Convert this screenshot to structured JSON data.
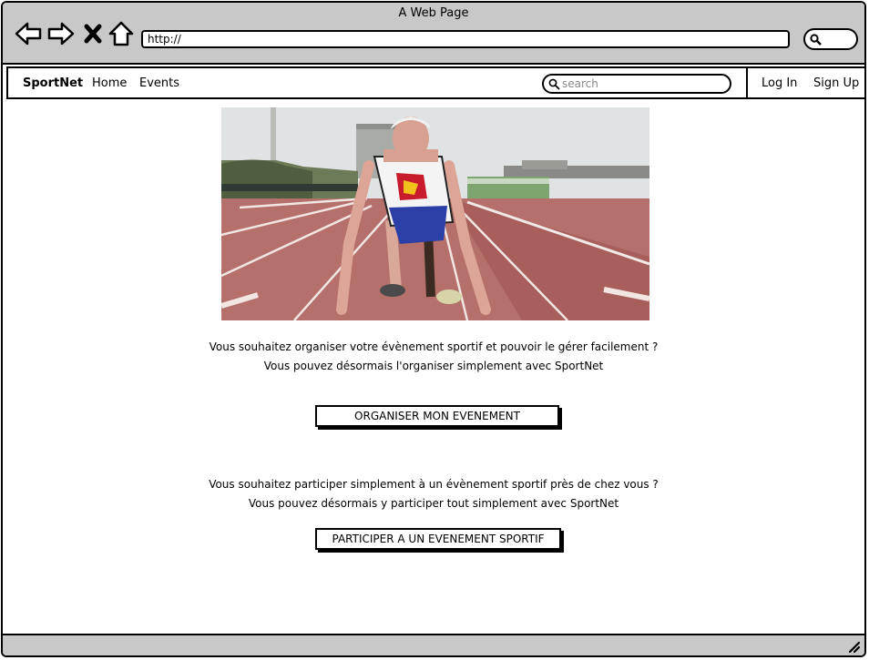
{
  "browser": {
    "window_title": "A Web Page",
    "url": "http://",
    "icons": [
      "back-arrow-icon",
      "forward-arrow-icon",
      "close-x-icon",
      "home-icon",
      "search-icon",
      "resize-grip-icon"
    ]
  },
  "nav": {
    "brand": "SportNet",
    "links": [
      "Home",
      "Events"
    ],
    "search_placeholder": "search",
    "login": "Log In",
    "signup": "Sign Up"
  },
  "main": {
    "organize": {
      "line1": "Vous souhaitez organiser votre évènement sportif et pouvoir le gérer facilement ?",
      "line2": "Vous pouvez désormais l'organiser simplement avec SportNet",
      "button": "ORGANISER MON EVENEMENT"
    },
    "participate": {
      "line1": "Vous souhaitez participer simplement à un évènement sportif près de chez vous ?",
      "line2": "Vous pouvez désormais y participer tout simplement avec SportNet",
      "button": "PARTICIPER A UN EVENEMENT SPORTIF"
    }
  }
}
